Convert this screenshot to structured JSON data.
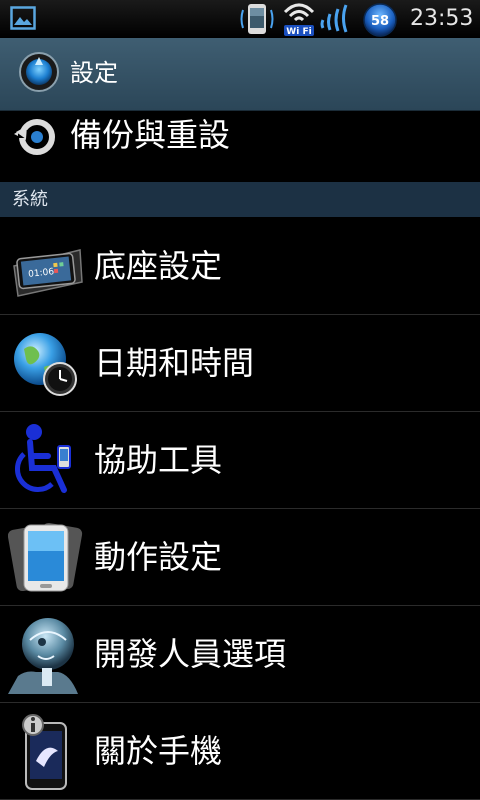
{
  "status_bar": {
    "time": "23:53",
    "battery_level": "58",
    "wifi_label": "Wi Fi"
  },
  "title_bar": {
    "title": "設定"
  },
  "backup_item": {
    "label": "備份與重設"
  },
  "section": {
    "label": "系統"
  },
  "items": [
    {
      "label": "底座設定",
      "icon": "dock-icon"
    },
    {
      "label": "日期和時間",
      "icon": "globe-clock-icon"
    },
    {
      "label": "協助工具",
      "icon": "accessibility-icon"
    },
    {
      "label": "動作設定",
      "icon": "motion-phone-icon"
    },
    {
      "label": "開發人員選項",
      "icon": "developer-xray-icon"
    },
    {
      "label": "關於手機",
      "icon": "about-phone-icon"
    }
  ],
  "dock_screen_time": "01:06"
}
